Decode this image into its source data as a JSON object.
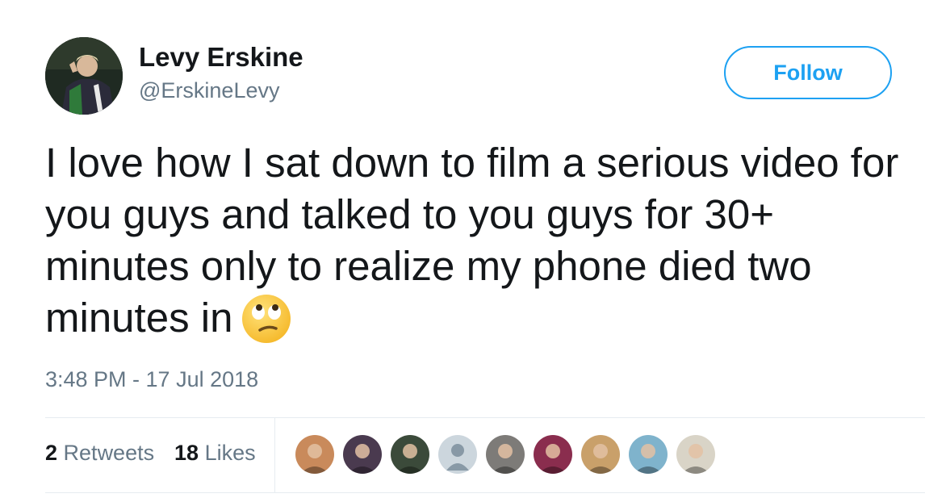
{
  "user": {
    "display_name": "Levy Erskine",
    "handle": "@ErskineLevy",
    "avatar_icon": "profile-photo-icon"
  },
  "follow_button": {
    "label": "Follow",
    "color": "#1da1f2"
  },
  "tweet": {
    "text": "I love how I sat down to film a serious video for you guys and talked to you guys for 30+ minutes only to realize my phone died two minutes in",
    "emoji": "face-with-rolling-eyes-icon",
    "timestamp": "3:48 PM - 17 Jul 2018"
  },
  "stats": {
    "retweets_count": "2",
    "retweets_label": "Retweets",
    "likes_count": "18",
    "likes_label": "Likes"
  },
  "liker_avatars": [
    {
      "name": "liker-avatar-1",
      "icon": "profile-photo-icon",
      "color": "#c98a5b"
    },
    {
      "name": "liker-avatar-2",
      "icon": "profile-photo-icon",
      "color": "#4a3a4f"
    },
    {
      "name": "liker-avatar-3",
      "icon": "profile-photo-icon",
      "color": "#3b4a3a"
    },
    {
      "name": "liker-avatar-4",
      "icon": "default-avatar-icon",
      "color": "#ccd6dd"
    },
    {
      "name": "liker-avatar-5",
      "icon": "profile-photo-icon",
      "color": "#7d7b78"
    },
    {
      "name": "liker-avatar-6",
      "icon": "profile-photo-icon",
      "color": "#8a2d4e"
    },
    {
      "name": "liker-avatar-7",
      "icon": "profile-photo-icon",
      "color": "#c9a06a"
    },
    {
      "name": "liker-avatar-8",
      "icon": "profile-photo-icon",
      "color": "#7fb3cc"
    },
    {
      "name": "liker-avatar-9",
      "icon": "profile-photo-icon",
      "color": "#d9d4c7"
    }
  ]
}
